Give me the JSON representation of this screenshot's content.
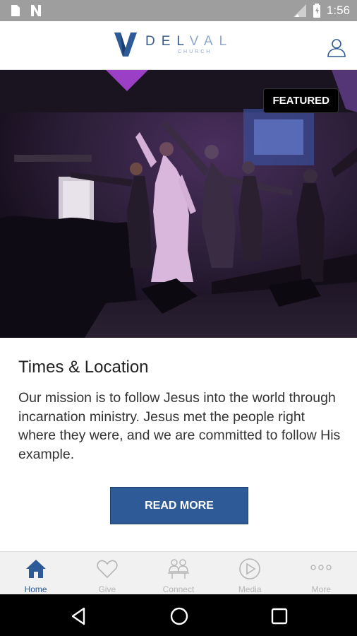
{
  "status_bar": {
    "time": "1:56"
  },
  "header": {
    "logo_word_del": "DEL",
    "logo_word_val": "VAL",
    "logo_sub": "CHURCH"
  },
  "hero": {
    "badge": "FEATURED"
  },
  "content": {
    "title": "Times & Location",
    "body": "Our mission is to follow Jesus into the world through incarnation ministry. Jesus met the people right where they were, and we are committed to follow His example.",
    "button_label": "READ MORE"
  },
  "tabs": [
    {
      "label": "Home",
      "icon": "home-icon",
      "active": true
    },
    {
      "label": "Give",
      "icon": "heart-icon",
      "active": false
    },
    {
      "label": "Connect",
      "icon": "people-icon",
      "active": false
    },
    {
      "label": "Media",
      "icon": "play-icon",
      "active": false
    },
    {
      "label": "More",
      "icon": "more-dots-icon",
      "active": false
    }
  ],
  "colors": {
    "accent": "#2e5b97",
    "status_bar": "#9e9e9e",
    "tab_bar": "#f1f1f1"
  }
}
